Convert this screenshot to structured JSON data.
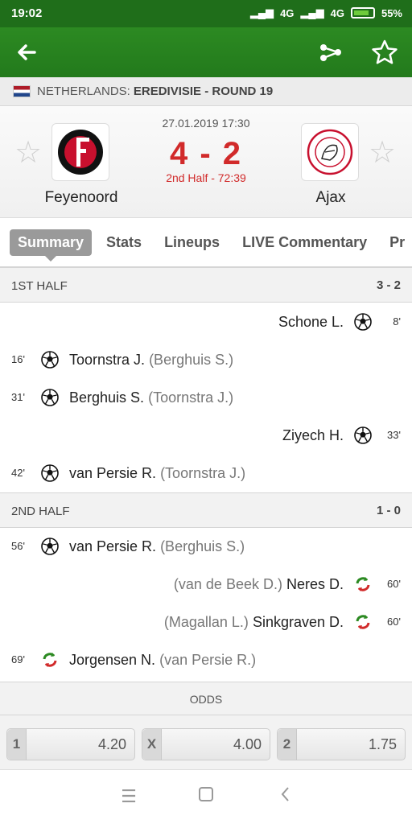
{
  "status_bar": {
    "time": "19:02",
    "network": "4G",
    "network2": "4G",
    "battery": "55%"
  },
  "appbar": {
    "back_icon": "arrow-left-icon",
    "share_icon": "share-icon",
    "favorite_icon": "star-outline-icon"
  },
  "league": {
    "country": "NETHERLANDS:",
    "competition": "EREDIVISIE - ROUND 19"
  },
  "match": {
    "datetime": "27.01.2019 17:30",
    "score": "4 - 2",
    "period": "2nd Half - 72:39",
    "home": {
      "name": "Feyenoord"
    },
    "away": {
      "name": "Ajax"
    }
  },
  "tabs": [
    "Summary",
    "Stats",
    "Lineups",
    "LIVE Commentary",
    "Pr"
  ],
  "first_half": {
    "label": "1ST HALF",
    "score": "3 - 2",
    "events": [
      {
        "side": "away",
        "minute": "8'",
        "type": "goal",
        "player": "Schone L.",
        "assist": ""
      },
      {
        "side": "home",
        "minute": "16'",
        "type": "goal",
        "player": "Toornstra J.",
        "assist": "(Berghuis S.)"
      },
      {
        "side": "home",
        "minute": "31'",
        "type": "goal",
        "player": "Berghuis S.",
        "assist": "(Toornstra J.)"
      },
      {
        "side": "away",
        "minute": "33'",
        "type": "goal",
        "player": "Ziyech H.",
        "assist": ""
      },
      {
        "side": "home",
        "minute": "42'",
        "type": "goal",
        "player": "van Persie R.",
        "assist": "(Toornstra J.)"
      }
    ]
  },
  "second_half": {
    "label": "2ND HALF",
    "score": "1 - 0",
    "events": [
      {
        "side": "home",
        "minute": "56'",
        "type": "goal",
        "player": "van Persie R.",
        "assist": "(Berghuis S.)"
      },
      {
        "side": "away",
        "minute": "60'",
        "type": "substitution",
        "player": "Neres D.",
        "assist": "(van de Beek D.)"
      },
      {
        "side": "away",
        "minute": "60'",
        "type": "substitution",
        "player": "Sinkgraven D.",
        "assist": "(Magallan L.)"
      },
      {
        "side": "home",
        "minute": "69'",
        "type": "substitution",
        "player": "Jorgensen N.",
        "assist": "(van Persie R.)"
      }
    ]
  },
  "odds": {
    "label": "ODDS",
    "items": [
      {
        "key": "1",
        "value": "4.20"
      },
      {
        "key": "X",
        "value": "4.00"
      },
      {
        "key": "2",
        "value": "1.75"
      }
    ]
  },
  "colors": {
    "brand_green": "#2c8a22",
    "score_red": "#d12a2a"
  }
}
